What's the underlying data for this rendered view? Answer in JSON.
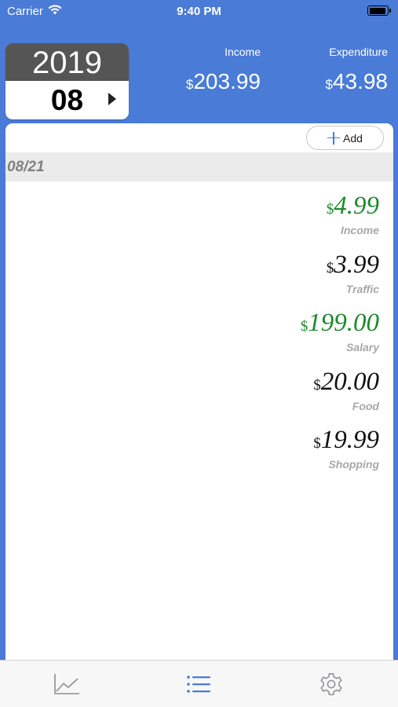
{
  "status_bar": {
    "carrier": "Carrier",
    "time": "9:40 PM",
    "wifi_icon": "wifi-icon",
    "battery_icon": "battery-icon"
  },
  "date_picker": {
    "year": "2019",
    "month": "08",
    "next_icon": "next-month-icon"
  },
  "summary": {
    "income_label": "Income",
    "income_currency": "$",
    "income_value": "203.99",
    "expenditure_label": "Expenditure",
    "expenditure_currency": "$",
    "expenditure_value": "43.98"
  },
  "toolbar": {
    "add_label": "Add",
    "add_icon": "plus-icon"
  },
  "section": {
    "date": "08/21"
  },
  "entries": [
    {
      "currency": "$",
      "amount": "4.99",
      "category": "Income",
      "type": "income"
    },
    {
      "currency": "$",
      "amount": "3.99",
      "category": "Traffic",
      "type": "expense"
    },
    {
      "currency": "$",
      "amount": "199.00",
      "category": "Salary",
      "type": "income"
    },
    {
      "currency": "$",
      "amount": "20.00",
      "category": "Food",
      "type": "expense"
    },
    {
      "currency": "$",
      "amount": "19.99",
      "category": "Shopping",
      "type": "expense"
    }
  ],
  "colors": {
    "accent": "#4a7bd6",
    "income": "#1e8a2a",
    "expense": "#111111",
    "category": "#a8a8a8"
  },
  "tab_bar": {
    "tabs": [
      {
        "icon": "chart-icon",
        "selected": false
      },
      {
        "icon": "list-icon",
        "selected": true
      },
      {
        "icon": "gear-icon",
        "selected": false
      }
    ]
  }
}
